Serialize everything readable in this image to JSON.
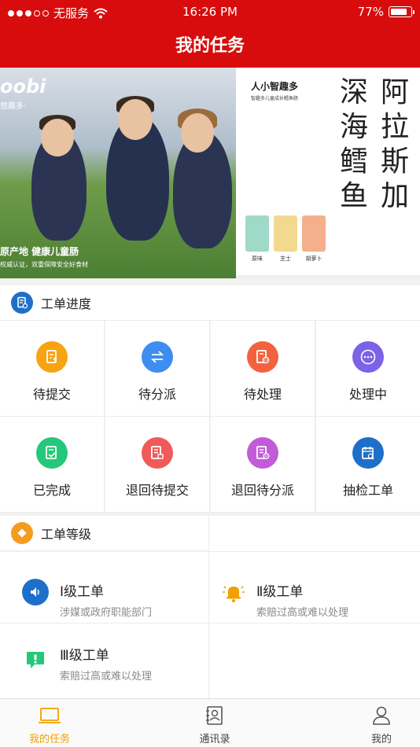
{
  "status_bar": {
    "carrier": "无服务",
    "time": "16:26 PM",
    "battery": "77%"
  },
  "header": {
    "title": "我的任务"
  },
  "banner": {
    "logo": "oobi",
    "logo_sub": "悠趣多·",
    "slogan": "原产地 健康儿童肠",
    "slogan_sub": "权威认证，双重保障安全好食材",
    "brand": "人小智趣多",
    "brand_sub": "智趣多儿童成长鳕鱼肠",
    "vertical_text_col1": "深海鳕鱼",
    "vertical_text_col2": "阿拉斯加",
    "flavors": [
      "原味",
      "芝士",
      "胡萝卜"
    ]
  },
  "progress": {
    "title": "工单进度",
    "items": [
      {
        "label": "待提交",
        "icon": "submit-doc-icon",
        "color": "#f7a312"
      },
      {
        "label": "待分派",
        "icon": "swap-arrows-icon",
        "color": "#3d8ef0"
      },
      {
        "label": "待处理",
        "icon": "pending-doc-icon",
        "color": "#f2623f"
      },
      {
        "label": "处理中",
        "icon": "more-dots-icon",
        "color": "#7b62e6"
      },
      {
        "label": "已完成",
        "icon": "done-doc-icon",
        "color": "#25c87a"
      },
      {
        "label": "退回待提交",
        "icon": "return-doc-icon",
        "color": "#f05a5a"
      },
      {
        "label": "退回待分派",
        "icon": "return-assign-icon",
        "color": "#c25bd8"
      },
      {
        "label": "抽检工单",
        "icon": "calendar-search-icon",
        "color": "#1e6fc9"
      }
    ]
  },
  "levels": {
    "title": "工单等级",
    "items": [
      {
        "title": "Ⅰ级工单",
        "desc": "涉媒或政府职能部门",
        "icon": "speaker-icon",
        "color": "#1e6fc9"
      },
      {
        "title": "Ⅱ级工单",
        "desc": "索赔过高或难以处理",
        "icon": "bell-icon",
        "color": "#f0a000"
      },
      {
        "title": "Ⅲ级工单",
        "desc": "索赔过高或难以处理",
        "icon": "alert-icon",
        "color": "#25c87a"
      }
    ]
  },
  "tabbar": {
    "items": [
      {
        "label": "我的任务",
        "active": true
      },
      {
        "label": "通讯录",
        "active": false
      },
      {
        "label": "我的",
        "active": false
      }
    ]
  },
  "colors": {
    "header_red": "#d80c0c",
    "tab_active": "#f0a000"
  }
}
